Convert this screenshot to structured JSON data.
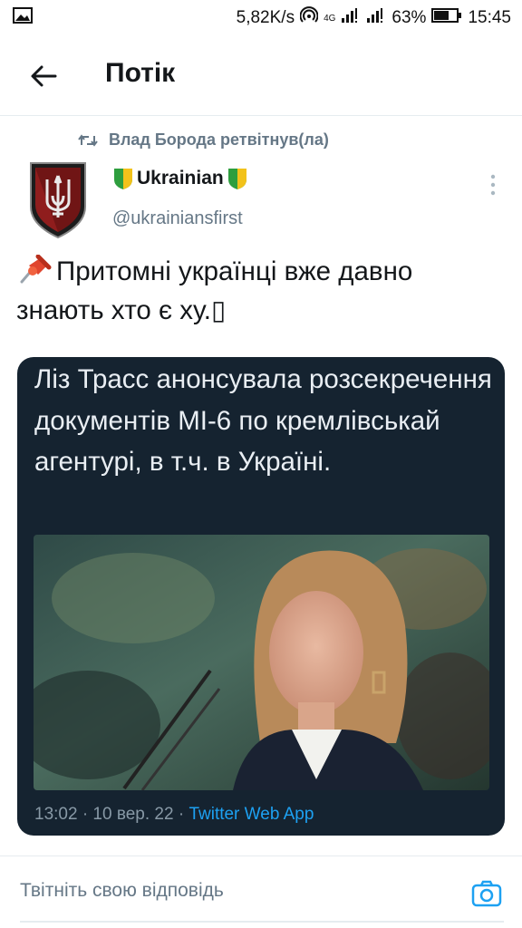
{
  "status_bar": {
    "speed": "5,82K/s",
    "network": "4G",
    "battery": "63%",
    "time": "15:45",
    "icons": [
      "gallery-icon",
      "hotspot-icon",
      "signal-icon",
      "signal-icon",
      "battery-icon"
    ]
  },
  "header": {
    "title": "Потік",
    "back_icon": "arrow-left-icon"
  },
  "tweet": {
    "retweet_label": "Влад Борода ретвітнув(ла)",
    "author": {
      "name": "Ukrainian",
      "handle": "@ukrainiansfirst"
    },
    "text": "Притомні українці вже давно знають хто є ху.▯",
    "media": {
      "caption": "Ліз Трасс анонсувала розсекречення документів МІ-6 по кремлівськай агентурі, в т.ч. в Україні.",
      "meta_time": "13:02 · 10 вер. 22 · ",
      "meta_app": "Twitter Web App"
    }
  },
  "reply": {
    "placeholder": "Твітніть свою відповідь"
  },
  "colors": {
    "accent": "#1da1f2",
    "secondary_text": "#657786",
    "media_bg": "#152330"
  }
}
